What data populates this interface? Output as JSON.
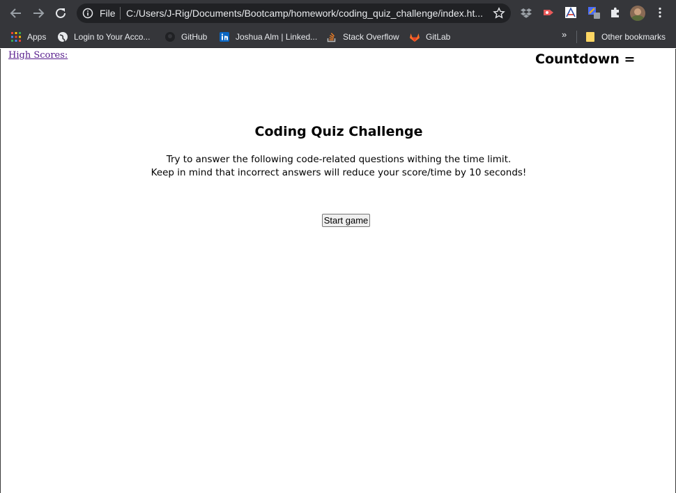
{
  "browser": {
    "omnibox": {
      "scheme_label": "File",
      "url": "C:/Users/J-Rig/Documents/Bootcamp/homework/coding_quiz_challenge/index.ht..."
    },
    "bookmarks": [
      {
        "label": "Apps",
        "icon": "apps-grid-icon"
      },
      {
        "label": "Login to Your Acco...",
        "icon": "globe-icon"
      },
      {
        "label": "GitHub",
        "icon": "github-icon"
      },
      {
        "label": "Joshua Alm | Linked...",
        "icon": "linkedin-icon"
      },
      {
        "label": "Stack Overflow",
        "icon": "stackoverflow-icon"
      },
      {
        "label": "GitLab",
        "icon": "gitlab-icon"
      }
    ],
    "more_label": "»",
    "other_bookmarks": "Other bookmarks"
  },
  "page": {
    "high_scores_label": "High Scores:",
    "countdown_label": "Countdown =",
    "title": "Coding Quiz Challenge",
    "intro_line1": "Try to answer the following code-related questions withing the time limit.",
    "intro_line2": "Keep in mind that incorrect answers will reduce your score/time by 10 seconds!",
    "start_button": "Start game"
  },
  "colors": {
    "chrome_bg": "#35363a",
    "omnibox_bg": "#202124",
    "visited_link": "#551a8b"
  }
}
